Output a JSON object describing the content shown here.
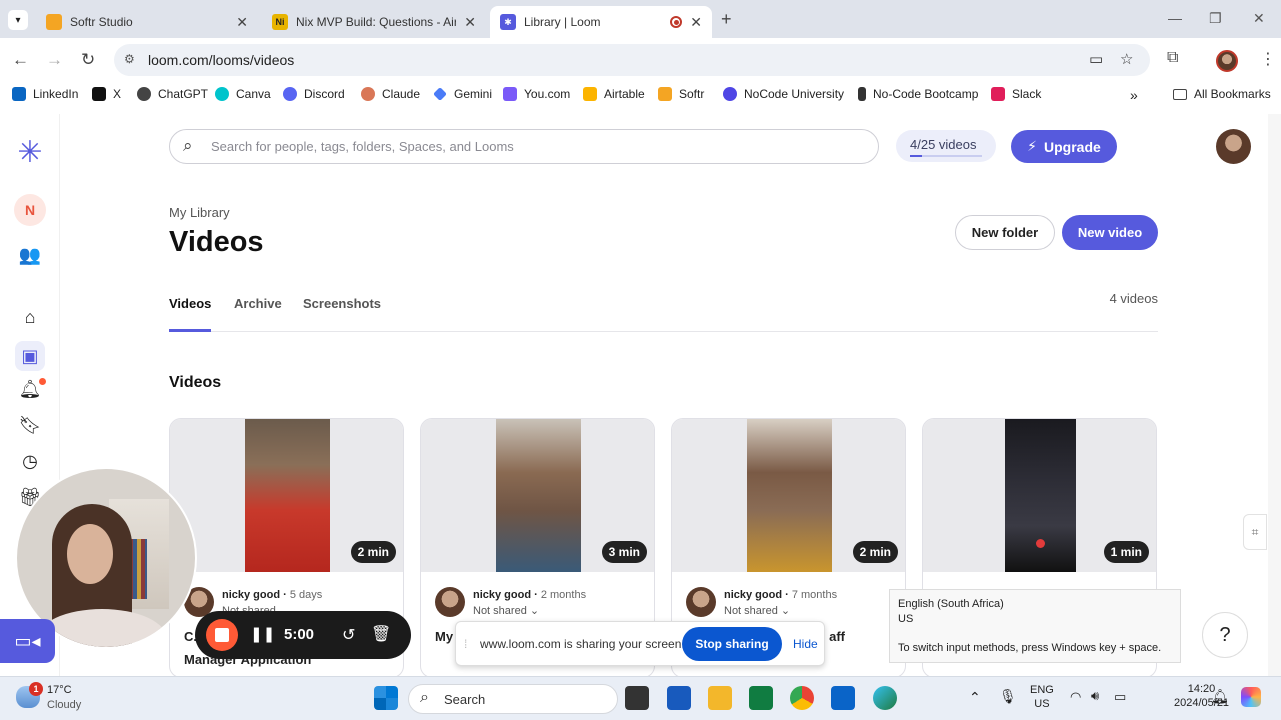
{
  "browser": {
    "tabs": [
      {
        "title": "Softr Studio",
        "color": "#f4a523"
      },
      {
        "title": "Nix MVP Build: Questions - Airt",
        "color": "#e8b400",
        "letter": "Ni"
      },
      {
        "title": "Library | Loom",
        "color": "#565add"
      }
    ],
    "url": "loom.com/looms/videos",
    "bookmarks": [
      {
        "label": "LinkedIn",
        "color": "#0a66c2"
      },
      {
        "label": "X",
        "color": "#111111"
      },
      {
        "label": "ChatGPT",
        "color": "#444444"
      },
      {
        "label": "Canva",
        "color": "#00c4cc"
      },
      {
        "label": "Discord",
        "color": "#5865f2"
      },
      {
        "label": "Claude",
        "color": "#d97757"
      },
      {
        "label": "Gemini",
        "color": "#4a7bf7"
      },
      {
        "label": "You.com",
        "color": "#7a5af8"
      },
      {
        "label": "Airtable",
        "color": "#fcb400"
      },
      {
        "label": "Softr",
        "color": "#f4a523"
      },
      {
        "label": "NoCode University",
        "color": "#4f46e5"
      },
      {
        "label": "No-Code Bootcamp",
        "color": "#333333"
      },
      {
        "label": "Slack",
        "color": "#e01e5a"
      }
    ],
    "all_bookmarks": "All Bookmarks",
    "overflow": "»"
  },
  "sidebar": {
    "workspace_initial": "N"
  },
  "header": {
    "search_placeholder": "Search for people, tags, folders, Spaces, and Looms",
    "quota": "4/25 videos",
    "quota_used": 4,
    "quota_total": 25,
    "upgrade": "Upgrade"
  },
  "page": {
    "breadcrumb": "My Library",
    "title": "Videos",
    "new_folder": "New folder",
    "new_video": "New video",
    "tabs": [
      "Videos",
      "Archive",
      "Screenshots"
    ],
    "count": "4 videos",
    "section": "Videos"
  },
  "videos": [
    {
      "duration": "2 min",
      "owner": "nicky good",
      "age": "5 days",
      "share": "Not shared",
      "title": "C...",
      "title2": "Manager Application"
    },
    {
      "duration": "3 min",
      "owner": "nicky good",
      "age": "2 months",
      "share": "Not shared",
      "title": "My"
    },
    {
      "duration": "2 min",
      "owner": "nicky good",
      "age": "7 months",
      "share": "Not shared",
      "title": "aff"
    },
    {
      "duration": "1 min"
    }
  ],
  "recorder": {
    "time": "5:00"
  },
  "screen_share": {
    "message": "www.loom.com is sharing your screen.",
    "stop": "Stop sharing",
    "hide": "Hide"
  },
  "ime_tooltip": {
    "line1": "English (South Africa)",
    "line2": "US",
    "line3": "To switch input methods, press Windows key + space."
  },
  "help": "?",
  "taskbar": {
    "weather_temp": "17°C",
    "weather_cond": "Cloudy",
    "weather_badge": "1",
    "search": "Search",
    "lang1": "ENG",
    "lang2": "US",
    "time": "14:20",
    "date": "2024/05/21"
  }
}
